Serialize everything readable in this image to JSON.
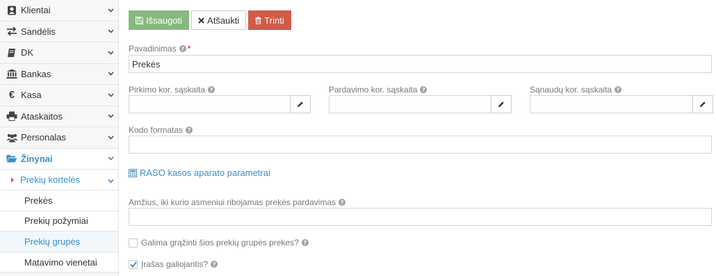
{
  "sidebar": {
    "items": [
      {
        "label": "Klientai",
        "icon": "user-icon"
      },
      {
        "label": "Sandėlis",
        "icon": "exchange-icon"
      },
      {
        "label": "DK",
        "icon": "book-icon"
      },
      {
        "label": "Bankas",
        "icon": "bank-icon"
      },
      {
        "label": "Kasa",
        "icon": "euro-icon"
      },
      {
        "label": "Ataskaitos",
        "icon": "print-icon"
      },
      {
        "label": "Personalas",
        "icon": "users-icon"
      },
      {
        "label": "Žinynai",
        "icon": "folder-open-icon"
      }
    ],
    "submenu": {
      "label": "Prekių kortelės"
    },
    "leaves": [
      "Prekės",
      "Prekių požymiai",
      "Prekių grupės",
      "Matavimo vienetai"
    ]
  },
  "toolbar": {
    "save_label": "Išsaugoti",
    "cancel_label": "Atšaukti",
    "delete_label": "Trinti"
  },
  "form": {
    "name_label": "Pavadinimas",
    "name_value": "Prekės",
    "purchase_account_label": "Pirkimo kor. sąskaita",
    "sales_account_label": "Pardavimo kor. sąskaita",
    "expense_account_label": "Sąnaudų kor. sąskaita",
    "code_format_label": "Kodo formatas",
    "raso_link": "RASO kasos aparato parametrai",
    "age_limit_label": "Amžius, iki kurio asmeniui ribojamas prekės pardavimas",
    "returnable_label": "Galima grąžinti šios prekių grupės prekes?",
    "returnable_checked": false,
    "valid_label": "Įrašas galiojantis?",
    "valid_checked": true
  },
  "colors": {
    "accent": "#3b8ec9",
    "save": "#87b87f",
    "delete": "#d15b47"
  }
}
